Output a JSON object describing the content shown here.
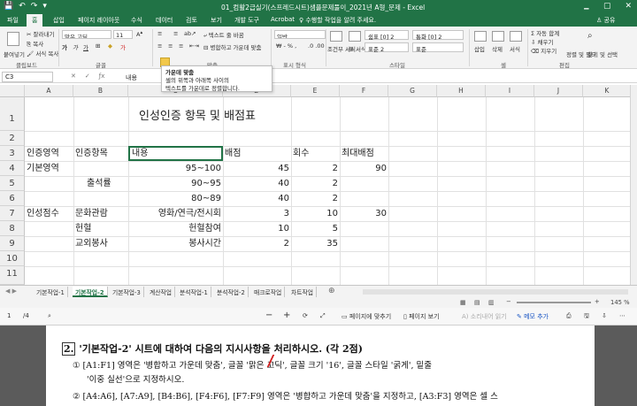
{
  "window": {
    "title": "01_컴활2급실기(스프레드시트)샘플문제풀이_2021년 A형_문제 - Excel",
    "qat": [
      "💾",
      "↶",
      "↷",
      "▾"
    ],
    "controls": [
      "🗕",
      "▢",
      "✕"
    ]
  },
  "ribbon_tabs": [
    "파일",
    "홈",
    "삽입",
    "페이지 레이아웃",
    "수식",
    "데이터",
    "검토",
    "보기",
    "개발 도구",
    "Acrobat"
  ],
  "tell_me": "수행할 작업을 알려 주세요.",
  "share": "공유",
  "ribbon": {
    "clipboard": {
      "paste": "붙여넣기",
      "cut": "잘라내기",
      "copy": "복사",
      "format_painter": "서식 복사",
      "label": "클립보드"
    },
    "font": {
      "name": "맑은 고딕",
      "size": "11",
      "label": "글꼴"
    },
    "alignment": {
      "wrap": "텍스트 줄 바꿈",
      "merge": "병합하고 가운데 맞춤",
      "label": "맞춤"
    },
    "number": {
      "format": "일반",
      "label": "표시 형식"
    },
    "styles": {
      "conditional": "조건부 서식",
      "table": "표 서식",
      "label": "스타일",
      "cells": [
        "쉼표 [0] 2",
        "통화 [0] 2",
        "표준 2",
        "표준"
      ]
    },
    "cells": {
      "insert": "삽입",
      "delete": "삭제",
      "format": "서식",
      "label": "셀"
    },
    "editing": {
      "autosum": "자동 합계",
      "fill": "채우기",
      "clear": "지우기",
      "sort": "정렬 및 필터",
      "find": "찾기 및 선택",
      "label": "편집"
    }
  },
  "tooltip": {
    "title": "가운데 맞춤",
    "body1": "셀의 위쪽과 아래쪽 사이의",
    "body2": "텍스트를 가운데로 정렬합니다."
  },
  "formula_bar": {
    "name_box": "C3",
    "value": "내용"
  },
  "columns": [
    "A",
    "B",
    "C",
    "D",
    "E",
    "F",
    "G",
    "H",
    "I",
    "J",
    "K"
  ],
  "rows": [
    "1",
    "2",
    "3",
    "4",
    "5",
    "6",
    "7",
    "8",
    "9",
    "10",
    "11"
  ],
  "sheet": {
    "title": "인성인증 항목 및 배점표",
    "header": {
      "a": "인증영역",
      "b": "인증항목",
      "c": "내용",
      "d": "배점",
      "e": "회수",
      "f": "최대배점"
    },
    "rows": [
      {
        "a": "기본영역",
        "b": "",
        "c": "95~100",
        "d": "45",
        "e": "2",
        "f": "90"
      },
      {
        "a": "",
        "b": "출석률",
        "c": "90~95",
        "d": "40",
        "e": "2",
        "f": ""
      },
      {
        "a": "",
        "b": "",
        "c": "80~89",
        "d": "40",
        "e": "2",
        "f": ""
      },
      {
        "a": "인성점수",
        "b": "문화관람",
        "c": "영화/연극/전시회",
        "d": "3",
        "e": "10",
        "f": "30"
      },
      {
        "a": "",
        "b": "헌혈",
        "c": "헌혈참여",
        "d": "10",
        "e": "5",
        "f": ""
      },
      {
        "a": "",
        "b": "교외봉사",
        "c": "봉사시간",
        "d": "2",
        "e": "35",
        "f": ""
      }
    ]
  },
  "sheet_tabs": [
    "기본작업-1",
    "기본작업-2",
    "기본작업-3",
    "계산작업",
    "분석작업-1",
    "분석작업-2",
    "매크로작업",
    "차트작업"
  ],
  "active_sheet": "기본작업-2",
  "status": {
    "zoom": "145 %"
  },
  "pdf_toolbar": {
    "page": "1",
    "total": "/4",
    "fit_page": "페이지에 맞추기",
    "page_view": "페이지 보기",
    "read_aloud": "소리내어 읽기",
    "add_note": "메모 추가"
  },
  "document": {
    "question_num": "2.",
    "question": "'기본작업-2' 시트에 대하여 다음의 지시사항을 처리하시오. (각 2점)",
    "item1_line1": "① [A1:F1] 영역은 '병합하고 가운데 맞춤', 글꼴 '맑은 고딕', 글꼴 크기 '16', 글꼴 스타일 '굵게', 밑줄",
    "item1_line2": "'이중 실선'으로 지정하시오.",
    "item2_line1": "② [A4:A6], [A7:A9], [B4:B6], [F4:F6], [F7:F9] 영역은 '병합하고 가운데 맞춤'을 지정하고, [A3:F3] 영역은 셀 스"
  }
}
